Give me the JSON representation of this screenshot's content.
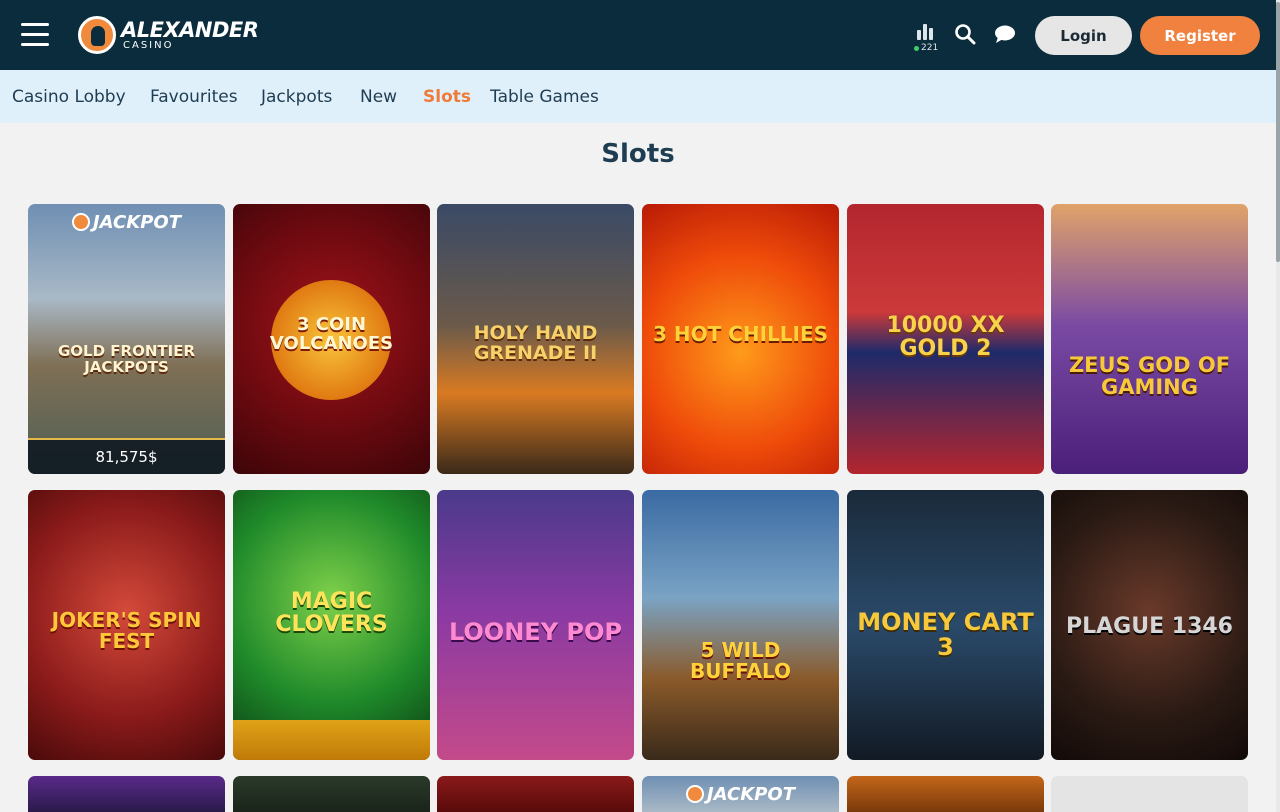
{
  "header": {
    "logo_main": "ALEXANDER",
    "logo_sub": "CASINO",
    "online_count": "221",
    "login_label": "Login",
    "register_label": "Register"
  },
  "subnav": {
    "items": [
      {
        "label": "Casino Lobby",
        "active": false
      },
      {
        "label": "Favourites",
        "active": false
      },
      {
        "label": "Jackpots",
        "active": false
      },
      {
        "label": "New",
        "active": false
      },
      {
        "label": "Slots",
        "active": true
      },
      {
        "label": "Table Games",
        "active": false
      }
    ]
  },
  "page": {
    "title": "Slots"
  },
  "jackpot_badge": "JACKPOT",
  "games": [
    {
      "name": "GOLD FRONTIER JACKPOTS",
      "jackpot_amount": "81,575$"
    },
    {
      "name": "3 COIN VOLCANOES"
    },
    {
      "name": "HOLY HAND GRENADE II"
    },
    {
      "name": "3 HOT CHILLIES"
    },
    {
      "name": "10000 XX GOLD 2"
    },
    {
      "name": "ZEUS GOD OF GAMING"
    },
    {
      "name": "JOKER'S SPIN FEST"
    },
    {
      "name": "MAGIC CLOVERS"
    },
    {
      "name": "LOONEY POP"
    },
    {
      "name": "5 WILD BUFFALO"
    },
    {
      "name": "MONEY CART 3"
    },
    {
      "name": "PLAGUE 1346"
    }
  ],
  "colors": {
    "header_bg": "#0b2c3c",
    "accent": "#f0813f",
    "subnav_bg": "#dff0fb",
    "active_tab": "#ef7a3a"
  }
}
